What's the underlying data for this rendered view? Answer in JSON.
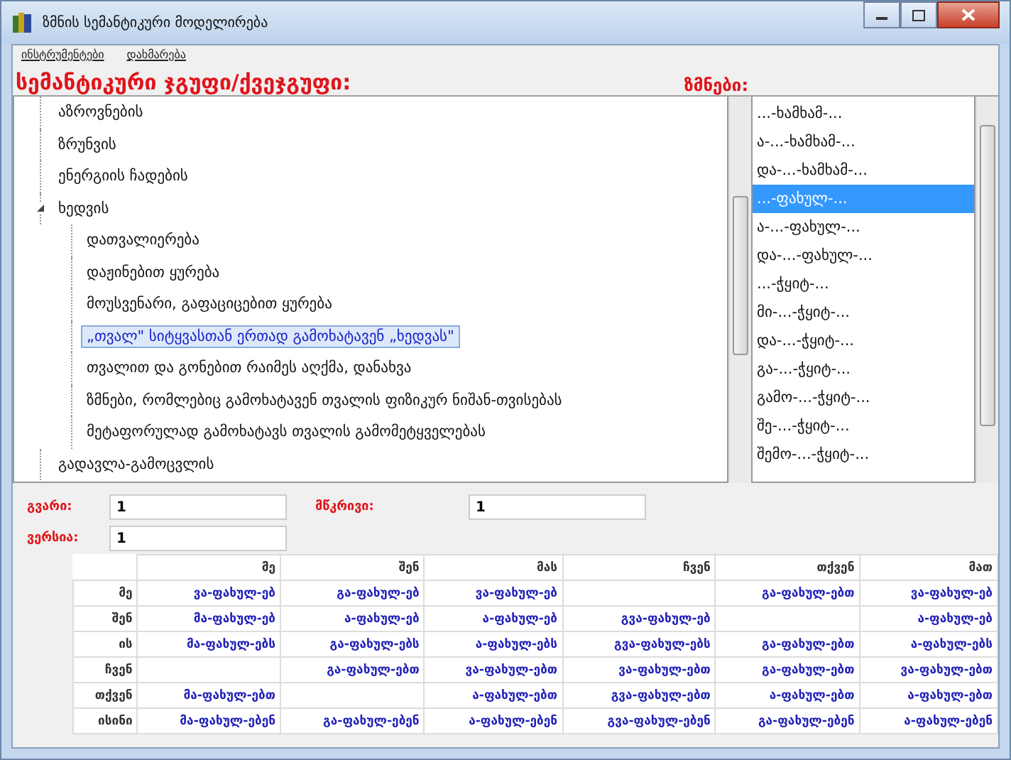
{
  "window": {
    "title": "ზმნის სემანტიკური მოდელირება"
  },
  "menu": [
    "ინსტრუმენტები",
    "დახმარება"
  ],
  "group_heading": "სემანტიკური ჯგუფი/ქვეჯგუფი:",
  "verbs_heading": "ზმნები:",
  "tree": [
    {
      "label": "აზროვნების",
      "selected": false
    },
    {
      "label": "ზრუნვის",
      "selected": false
    },
    {
      "label": "ენერგიის ჩადების",
      "selected": false
    },
    {
      "label": "ხედვის",
      "selected": false,
      "expanded": true,
      "children": [
        {
          "label": "დათვალიერება",
          "selected": false
        },
        {
          "label": "დაჟინებით ყურება",
          "selected": false
        },
        {
          "label": "მოუსვენარი, გაფაციცებით ყურება",
          "selected": false
        },
        {
          "label": "„თვალ\" სიტყვასთან ერთად გამოხატავენ „ხედვას\"",
          "selected": true
        },
        {
          "label": "თვალით და გონებით რაიმეს აღქმა, დანახვა",
          "selected": false
        },
        {
          "label": "ზმნები, რომლებიც გამოხატავენ თვალის ფიზიკურ ნიშან-თვისებას",
          "selected": false
        },
        {
          "label": "მეტაფორულად გამოხატავს თვალის გამომეტყველებას",
          "selected": false
        }
      ]
    },
    {
      "label": "გადავლა-გამოცვლის",
      "selected": false
    }
  ],
  "verbs": [
    {
      "label": "...-ხამხამ-...",
      "selected": false
    },
    {
      "label": "ა-...-ხამხამ-...",
      "selected": false
    },
    {
      "label": "და-...-ხამხამ-...",
      "selected": false
    },
    {
      "label": "...-ფახულ-...",
      "selected": true
    },
    {
      "label": "ა-...-ფახულ-...",
      "selected": false
    },
    {
      "label": "და-...-ფახულ-...",
      "selected": false
    },
    {
      "label": "...-ჭყიტ-...",
      "selected": false
    },
    {
      "label": "მი-...-ჭყიტ-...",
      "selected": false
    },
    {
      "label": "და-...-ჭყიტ-...",
      "selected": false
    },
    {
      "label": "გა-...-ჭყიტ-...",
      "selected": false
    },
    {
      "label": "გამო-...-ჭყიტ-...",
      "selected": false
    },
    {
      "label": "შე-...-ჭყიტ-...",
      "selected": false
    },
    {
      "label": "შემო-...-ჭყიტ-...",
      "selected": false
    }
  ],
  "fields": [
    {
      "label": "გვარი:",
      "value": "1"
    },
    {
      "label": "მწკრივი:",
      "value": "1"
    },
    {
      "label": "ვერსია:",
      "value": "1"
    }
  ],
  "table": {
    "columns": [
      "მე",
      "შენ",
      "მას",
      "ჩვენ",
      "თქვენ",
      "მათ"
    ],
    "rows": [
      {
        "person": "მე",
        "cells": [
          "ვა-ფახულ-ებ",
          "გა-ფახულ-ებ",
          "ვა-ფახულ-ებ",
          null,
          "გა-ფახულ-ებთ",
          "ვა-ფახულ-ებ"
        ]
      },
      {
        "person": "შენ",
        "cells": [
          "მა-ფახულ-ებ",
          "ა-ფახულ-ებ",
          "ა-ფახულ-ებ",
          "გვა-ფახულ-ებ",
          null,
          "ა-ფახულ-ებ"
        ]
      },
      {
        "person": "ის",
        "cells": [
          "მა-ფახულ-ებს",
          "გა-ფახულ-ებს",
          "ა-ფახულ-ებს",
          "გვა-ფახულ-ებს",
          "გა-ფახულ-ებთ",
          "ა-ფახულ-ებს"
        ]
      },
      {
        "person": "ჩვენ",
        "cells": [
          null,
          "გა-ფახულ-ებთ",
          "ვა-ფახულ-ებთ",
          "ვა-ფახულ-ებთ",
          "გა-ფახულ-ებთ",
          "ვა-ფახულ-ებთ"
        ]
      },
      {
        "person": "თქვენ",
        "cells": [
          "მა-ფახულ-ებთ",
          null,
          "ა-ფახულ-ებთ",
          "გვა-ფახულ-ებთ",
          "ა-ფახულ-ებთ",
          "ა-ფახულ-ებთ"
        ]
      },
      {
        "person": "ისინი",
        "cells": [
          "მა-ფახულ-ებენ",
          "გა-ფახულ-ებენ",
          "ა-ფახულ-ებენ",
          "გვა-ფახულ-ებენ",
          "გა-ფახულ-ებენ",
          "ა-ფახულ-ებენ"
        ]
      }
    ]
  }
}
